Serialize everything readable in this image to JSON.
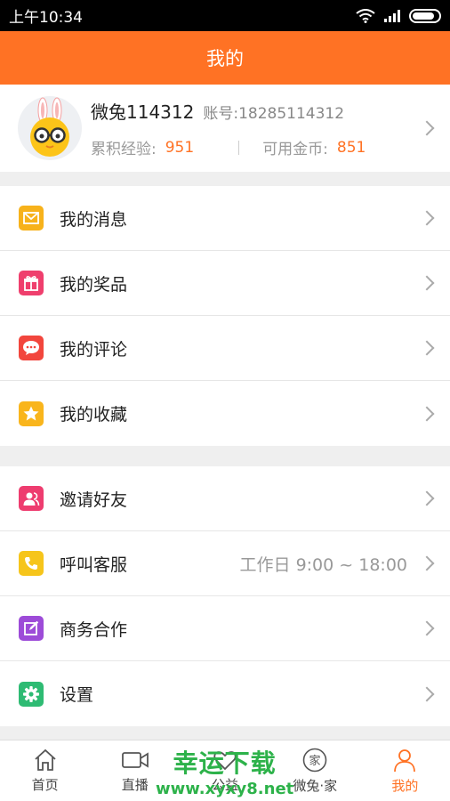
{
  "status_bar": {
    "time": "上午10:34"
  },
  "title": "我的",
  "profile": {
    "name": "微兔114312",
    "account": "账号:18285114312",
    "exp_label": "累积经验:",
    "exp_value": "951",
    "coins_label": "可用金币:",
    "coins_value": "851"
  },
  "group1": [
    {
      "label": "我的消息",
      "icon": "mail-icon",
      "color": "#f7b21b"
    },
    {
      "label": "我的奖品",
      "icon": "gift-icon",
      "color": "#ef3f6d"
    },
    {
      "label": "我的评论",
      "icon": "comment-icon",
      "color": "#f2463d"
    },
    {
      "label": "我的收藏",
      "icon": "star-icon",
      "color": "#f9b51c"
    }
  ],
  "group2": [
    {
      "label": "邀请好友",
      "icon": "invite-icon",
      "color": "#ee3c6f"
    },
    {
      "label": "呼叫客服",
      "icon": "phone-icon",
      "color": "#f6c51b",
      "extra": "工作日   9:00 ~ 18:00"
    },
    {
      "label": "商务合作",
      "icon": "edit-icon",
      "color": "#9d4bd8"
    },
    {
      "label": "设置",
      "icon": "gear-icon",
      "color": "#2ebb73"
    }
  ],
  "tabs": [
    {
      "label": "首页",
      "icon": "home-icon"
    },
    {
      "label": "直播",
      "icon": "video-icon"
    },
    {
      "label": "公益",
      "icon": "charity-icon"
    },
    {
      "label": "微兔·家",
      "icon": "home-circle-icon"
    },
    {
      "label": "我的",
      "icon": "person-icon",
      "active": true
    }
  ],
  "watermark": {
    "line1": "幸运下载",
    "line2": "www.xyxy8.net"
  },
  "colors": {
    "accent": "#ff7224",
    "watermark": "#2db24a"
  }
}
